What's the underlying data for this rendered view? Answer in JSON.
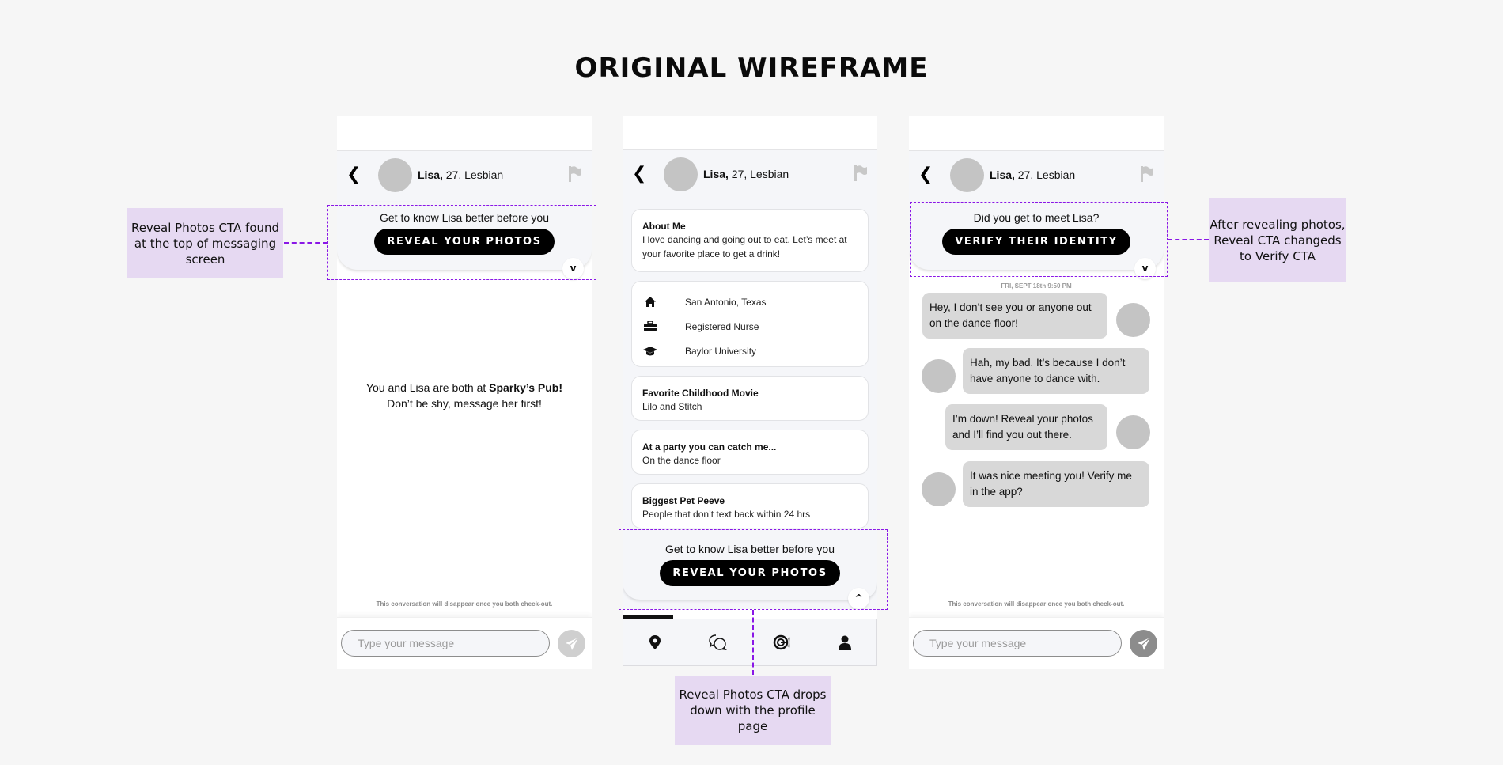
{
  "page_title": "ORIGINAL WIREFRAME",
  "profile": {
    "name": "Lisa,",
    "details": " 27, Lesbian"
  },
  "screen1": {
    "cta_text": "Get to know Lisa better before you",
    "cta_button": "REVEAL YOUR PHOTOS",
    "cta_toggle": "v",
    "empty_line1_prefix": "You and Lisa are both at ",
    "empty_line1_bold": "Sparky’s Pub!",
    "empty_line2": "Don’t be shy, message her first!",
    "disclaimer": "This conversation will disappear once you both check-out.",
    "input_placeholder": "Type your message"
  },
  "screen2": {
    "cards": [
      {
        "title": "About Me",
        "body": "I love dancing and going out to eat. Let’s meet at your favorite place to get a drink!"
      },
      {
        "title": "Favorite Childhood Movie",
        "body": "Lilo and Stitch"
      },
      {
        "title": "At a party you can catch me...",
        "body": "On the dance floor"
      },
      {
        "title": "Biggest Pet Peeve",
        "body": "People that don’t text back within 24 hrs"
      }
    ],
    "info": [
      {
        "icon": "home-icon",
        "text": "San Antonio, Texas"
      },
      {
        "icon": "briefcase-icon",
        "text": "Registered Nurse"
      },
      {
        "icon": "graduation-cap-icon",
        "text": "Baylor University"
      }
    ],
    "cta_text": "Get to know Lisa better before you",
    "cta_button": "REVEAL YOUR PHOTOS",
    "cta_toggle": "^",
    "tabs": [
      {
        "icon": "location-pin-icon",
        "active": true
      },
      {
        "icon": "chat-bubbles-icon",
        "active": false
      },
      {
        "icon": "radar-icon",
        "active": false
      },
      {
        "icon": "profile-icon",
        "active": false
      }
    ]
  },
  "screen3": {
    "cta_text": "Did you get to meet Lisa?",
    "cta_button": "VERIFY THEIR IDENTITY",
    "cta_toggle": "v",
    "timestamp": "FRI, SEPT 18th 9:50 PM",
    "messages": [
      {
        "sender": "me",
        "text": "Hey, I don’t see you or anyone out on the dance floor!"
      },
      {
        "sender": "them",
        "text": "Hah, my bad. It’s because I don’t have anyone to dance with."
      },
      {
        "sender": "me",
        "text": "I’m down! Reveal your photos and I’ll find you out there."
      },
      {
        "sender": "them",
        "text": "It was nice meeting you! Verify me in the app?"
      }
    ],
    "disclaimer": "This conversation will disappear once you both check-out.",
    "input_placeholder": "Type your message"
  },
  "annotations": {
    "left": "Reveal Photos CTA found at the top of messaging screen",
    "center": "Reveal Photos CTA drops down with the profile page",
    "right": "After revealing photos, Reveal CTA changeds to Verify CTA"
  },
  "colors": {
    "annotation_bg": "#e6d9f2",
    "annotation_dash": "#8a17e6",
    "cta_button_bg": "#000000",
    "bubble_bg": "#d8d8d8",
    "avatar_placeholder": "#c4c4c4"
  }
}
